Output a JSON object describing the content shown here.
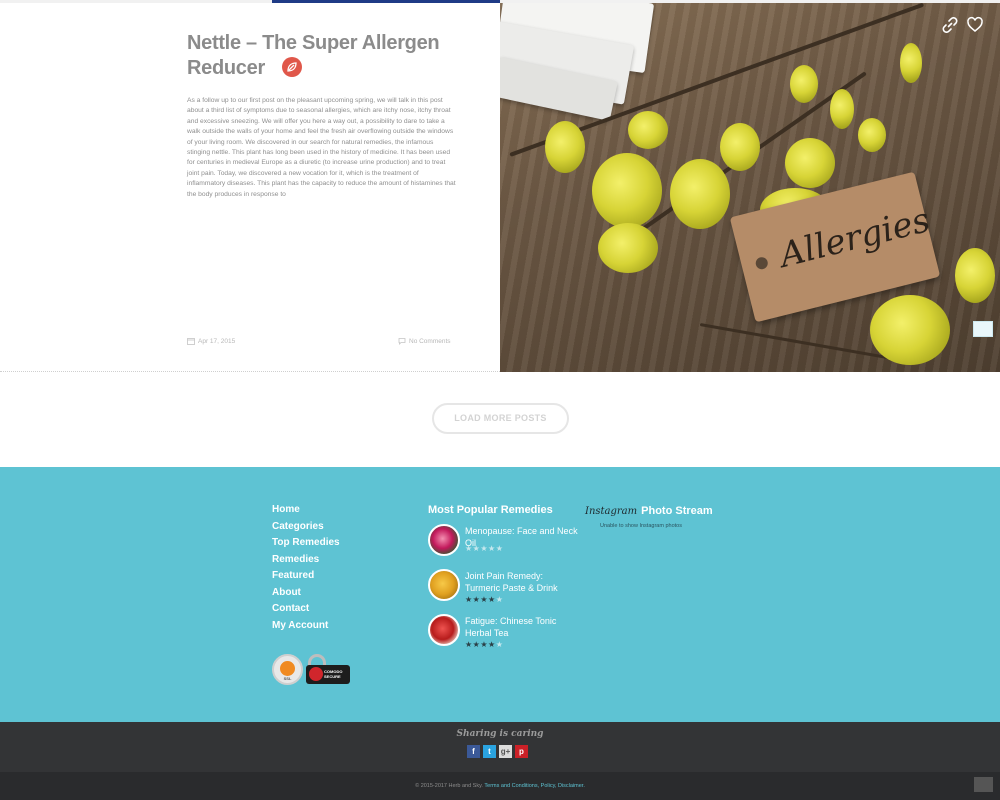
{
  "article": {
    "title": "Nettle – The Super Allergen Reducer",
    "excerpt": "As a follow up to our first post on the pleasant upcoming spring, we will talk in this post about a third list of symptoms due to seasonal allergies, which are itchy nose, itchy throat and excessive sneezing. We will offer you here a way out, a possibility to dare to take a walk outside the walls of your home and feel the fresh air overflowing outside the windows of your living room. We discovered in our search for natural remedies, the infamous stinging nettle. This plant has long been used in the history of medicine. It has been used for centuries in medieval Europe as a diuretic (to increase urine production) and to treat joint pain. Today, we discovered a new vocation for it, which is the treatment of inflammatory diseases. This plant has the capacity to reduce the amount of histamines that the body produces in response to",
    "date": "Apr 17, 2015",
    "comments": "No Comments",
    "image_tag_text": "Allergies",
    "category_icon": "leaf-badge-icon"
  },
  "load_more": {
    "label": "LOAD MORE POSTS"
  },
  "footer": {
    "nav": [
      "Home",
      "Categories",
      "Top Remedies",
      "Remedies",
      "Featured",
      "About",
      "Contact",
      "My Account"
    ],
    "badges": {
      "ssl": "SSL",
      "comodo": "COMODO SECURE"
    },
    "popular": {
      "heading": "Most Popular Remedies",
      "items": [
        {
          "title": "Menopause: Face and Neck Oil",
          "rating": 0,
          "thumb_color": "#c2185b"
        },
        {
          "title": "Joint Pain Remedy: Turmeric Paste & Drink",
          "rating": 4,
          "thumb_color": "#e0a020"
        },
        {
          "title": "Fatigue: Chinese Tonic Herbal Tea",
          "rating": 4,
          "thumb_color": "#b71c1c"
        }
      ]
    },
    "instagram": {
      "logo": "Instagram",
      "heading": "Photo Stream",
      "message": "Unable to show Instagram photos"
    }
  },
  "share": {
    "title": "Sharing is caring",
    "icons": [
      "f",
      "t",
      "g+",
      "p"
    ]
  },
  "copyright": {
    "text": "© 2015-2017 Herb and Sky.",
    "links": "Terms and Conditions, Policy, Disclaimer."
  },
  "colors": {
    "footer_bg": "#5ec3d3",
    "dark_bar": "#333436",
    "accent_badge": "#e0574a"
  }
}
